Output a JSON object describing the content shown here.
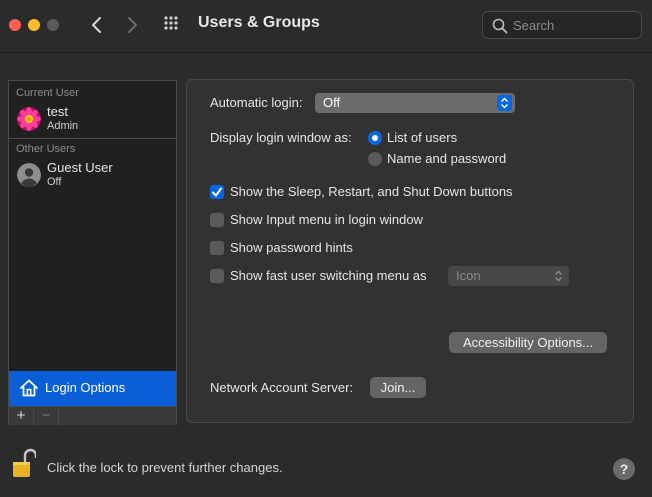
{
  "window": {
    "title": "Users & Groups"
  },
  "search": {
    "placeholder": "Search"
  },
  "sidebar": {
    "current_user_label": "Current User",
    "current_user": {
      "name": "test",
      "role": "Admin"
    },
    "other_users_label": "Other Users",
    "other_users": [
      {
        "name": "Guest User",
        "status": "Off"
      }
    ],
    "login_options_label": "Login Options",
    "add_label": "+",
    "remove_label": "−"
  },
  "panel": {
    "automatic_login": {
      "label": "Automatic login:",
      "value": "Off"
    },
    "display_login_window": {
      "label": "Display login window as:",
      "options": [
        {
          "label": "List of users",
          "selected": true
        },
        {
          "label": "Name and password",
          "selected": false
        }
      ]
    },
    "checkboxes": [
      {
        "label": "Show the Sleep, Restart, and Shut Down buttons",
        "checked": true
      },
      {
        "label": "Show Input menu in login window",
        "checked": false
      },
      {
        "label": "Show password hints",
        "checked": false
      },
      {
        "label": "Show fast user switching menu as",
        "checked": false
      }
    ],
    "fast_switching_value": "Icon",
    "accessibility_button": "Accessibility Options...",
    "network_account_label": "Network Account Server:",
    "join_button": "Join..."
  },
  "footer": {
    "lock_text": "Click the lock to prevent further changes.",
    "help_label": "?"
  },
  "colors": {
    "accent": "#0a66e0",
    "selection": "#0a5fd8",
    "window_bg": "#2b2b2b",
    "panel_bg": "#323232"
  },
  "icons": {
    "back": "chevron-left-icon",
    "forward": "chevron-right-icon",
    "grid": "grid-icon",
    "search": "search-icon",
    "login_options": "house-icon",
    "lock": "lock-open-icon",
    "help": "help-icon"
  }
}
